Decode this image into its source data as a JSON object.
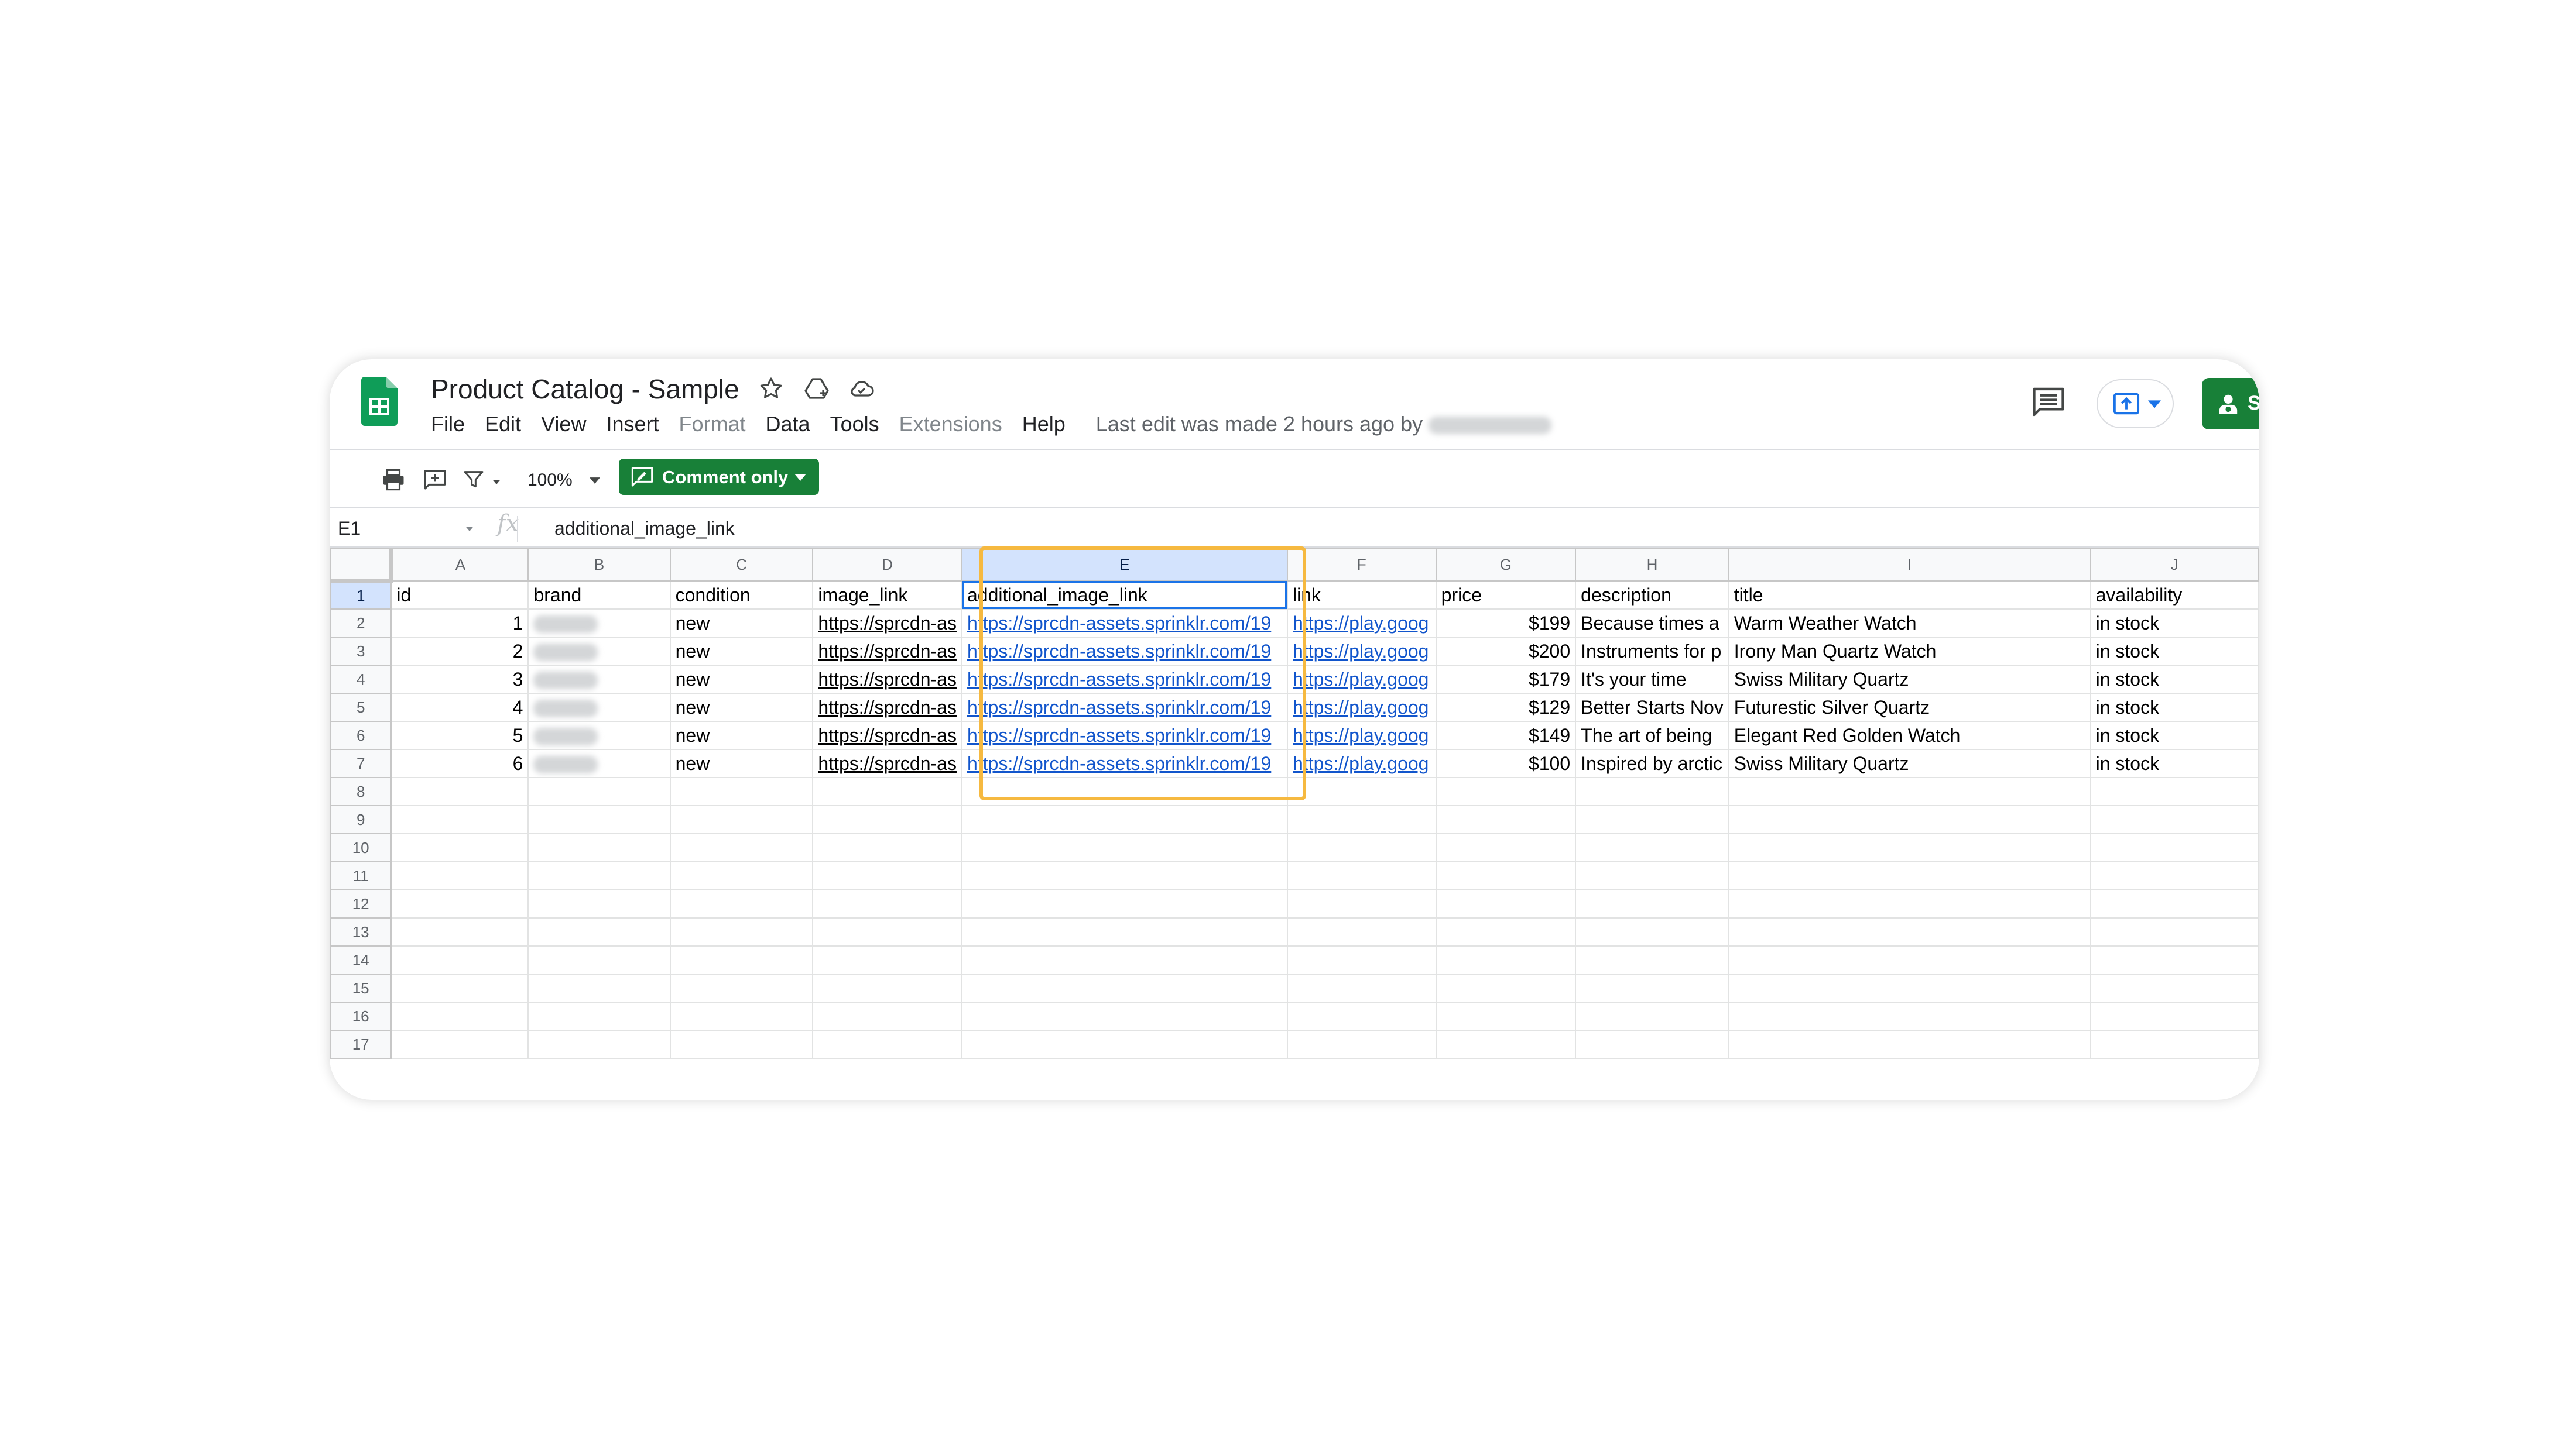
{
  "doc_title": "Product Catalog - Sample",
  "menu": [
    "File",
    "Edit",
    "View",
    "Insert",
    "Format",
    "Data",
    "Tools",
    "Extensions",
    "Help"
  ],
  "menu_disabled": [
    "Format",
    "Extensions"
  ],
  "last_edit": "Last edit was made 2 hours ago by",
  "share_label": "Sh",
  "toolbar": {
    "zoom": "100%",
    "mode_button": "Comment only"
  },
  "formula_bar": {
    "cell_ref": "E1",
    "fx": "fx",
    "content": "additional_image_link"
  },
  "grid": {
    "columns": [
      "A",
      "B",
      "C",
      "D",
      "E",
      "F",
      "G",
      "H",
      "I",
      "J"
    ],
    "selected_column": "E",
    "active_cell": "E1",
    "row_numbers": [
      "1",
      "2",
      "3",
      "4",
      "5",
      "6",
      "7",
      "8",
      "9",
      "10",
      "11",
      "12",
      "13",
      "14",
      "15",
      "16",
      "17"
    ],
    "header_row": [
      "id",
      "brand",
      "condition",
      "image_link",
      "additional_image_link",
      "link",
      "price",
      "description",
      "title",
      "availability"
    ],
    "rows": [
      {
        "id": "1",
        "condition": "new",
        "image_link": "https://sprcdn-as",
        "additional_image_link": "https://sprcdn-assets.sprinklr.com/19",
        "link": "https://play.goog",
        "price": "$199",
        "description": "Because times a",
        "title": "Warm Weather Watch",
        "availability": "in stock"
      },
      {
        "id": "2",
        "condition": "new",
        "image_link": "https://sprcdn-as",
        "additional_image_link": "https://sprcdn-assets.sprinklr.com/19",
        "link": "https://play.goog",
        "price": "$200",
        "description": "Instruments for p",
        "title": "Irony Man Quartz Watch",
        "availability": "in stock"
      },
      {
        "id": "3",
        "condition": "new",
        "image_link": "https://sprcdn-as",
        "additional_image_link": "https://sprcdn-assets.sprinklr.com/19",
        "link": "https://play.goog",
        "price": "$179",
        "description": "It's your time",
        "title": "Swiss Military Quartz",
        "availability": "in stock"
      },
      {
        "id": "4",
        "condition": "new",
        "image_link": "https://sprcdn-as",
        "additional_image_link": "https://sprcdn-assets.sprinklr.com/19",
        "link": "https://play.goog",
        "price": "$129",
        "description": "Better Starts Nov",
        "title": "Futurestic Silver Quartz",
        "availability": "in stock"
      },
      {
        "id": "5",
        "condition": "new",
        "image_link": "https://sprcdn-as",
        "additional_image_link": "https://sprcdn-assets.sprinklr.com/19",
        "link": "https://play.goog",
        "price": "$149",
        "description": "The art of being",
        "title": "Elegant Red Golden Watch",
        "availability": "in stock"
      },
      {
        "id": "6",
        "condition": "new",
        "image_link": "https://sprcdn-as",
        "additional_image_link": "https://sprcdn-assets.sprinklr.com/19",
        "link": "https://play.goog",
        "price": "$100",
        "description": "Inspired by arctic",
        "title": "Swiss Military Quartz",
        "availability": "in stock"
      }
    ]
  },
  "colors": {
    "sheets_green": "#188038",
    "link_blue": "#1155cc",
    "highlight_orange": "#f6b940",
    "selection_blue": "#d3e3fd"
  },
  "icons": [
    "sheets-logo-icon",
    "star-icon",
    "move-to-drive-icon",
    "cloud-saved-icon",
    "comments-icon",
    "present-icon",
    "share-person-icon",
    "print-icon",
    "add-comment-icon",
    "filter-icon",
    "dropdown-arrow-icon"
  ]
}
